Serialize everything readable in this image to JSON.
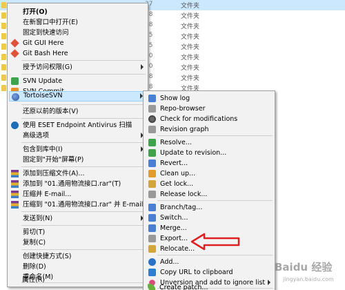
{
  "background_rows": [
    {
      "time": "37",
      "type": "文件夹"
    },
    {
      "time": "48",
      "type": "文件夹"
    },
    {
      "time": "48",
      "type": "文件夹"
    },
    {
      "time": "55",
      "type": "文件夹"
    },
    {
      "time": "55",
      "type": "文件夹"
    },
    {
      "time": "00",
      "type": "文件夹"
    },
    {
      "time": "00",
      "type": "文件夹"
    },
    {
      "time": "08",
      "type": "文件夹"
    },
    {
      "time": "08",
      "type": "文件夹"
    }
  ],
  "main_menu": {
    "open": "打开(O)",
    "open_new_window": "在新窗口中打开(E)",
    "pin_quick_access": "固定到快速访问",
    "git_gui": "Git GUI Here",
    "git_bash": "Git Bash Here",
    "grant_access": "授予访问权限(G)",
    "svn_update": "SVN Update",
    "svn_commit": "SVN Commit...",
    "tortoisesvn": "TortoiseSVN",
    "restore_versions": "还原以前的版本(V)",
    "eset_scan": "使用 ESET Endpoint Antivirus 扫描",
    "advanced": "高级选项",
    "include_library": "包含到库中(I)",
    "pin_start": "固定到\"开始\"屏幕(P)",
    "add_archive": "添加到压缩文件(A)...",
    "add_to_rar": "添加到 \"01.通用物流接口.rar\"(T)",
    "compress_email": "压缩并 E-mail...",
    "compress_rar_email": "压缩到 \"01.通用物流接口.rar\" 并 E-mail",
    "send_to": "发送到(N)",
    "cut": "剪切(T)",
    "copy": "复制(C)",
    "create_shortcut": "创建快捷方式(S)",
    "delete": "删除(D)",
    "rename": "重命名(M)",
    "properties": "属性(R)"
  },
  "sub_menu": {
    "show_log": "Show log",
    "repo_browser": "Repo-browser",
    "check_modifications": "Check for modifications",
    "revision_graph": "Revision graph",
    "resolve": "Resolve...",
    "update_revision": "Update to revision...",
    "revert": "Revert...",
    "clean_up": "Clean up...",
    "get_lock": "Get lock...",
    "release_lock": "Release lock...",
    "branch_tag": "Branch/tag...",
    "switch": "Switch...",
    "merge": "Merge...",
    "export": "Export...",
    "relocate": "Relocate...",
    "add": "Add...",
    "copy_url": "Copy URL to clipboard",
    "unversion": "Unversion and add to ignore list",
    "create_patch": "Create patch..."
  },
  "watermark": {
    "brand": "Baidu 经验",
    "sub": "jingyan.baidu.com"
  },
  "colors": {
    "highlight": "#cce8ff",
    "menu_bg": "#f2f2f2",
    "annotation": "#e02020"
  }
}
